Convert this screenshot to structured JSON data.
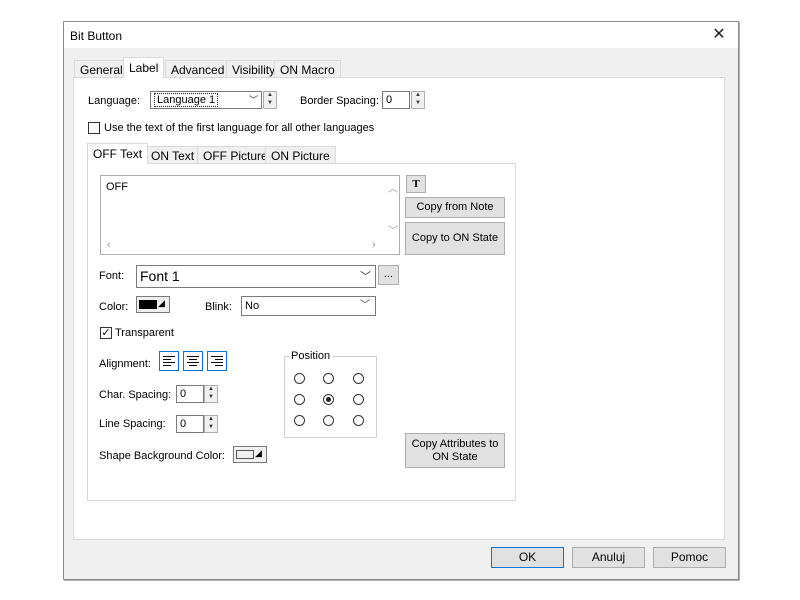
{
  "window": {
    "title": "Bit Button"
  },
  "main_tabs": [
    {
      "label": "General"
    },
    {
      "label": "Label"
    },
    {
      "label": "Advanced"
    },
    {
      "label": "Visibility"
    },
    {
      "label": "ON Macro"
    }
  ],
  "language": {
    "label": "Language:",
    "value": "Language 1"
  },
  "border_spacing": {
    "label": "Border Spacing:",
    "value": "0"
  },
  "use_first_language": {
    "label": "Use the text of the first language for all other languages",
    "checked": false
  },
  "sub_tabs": [
    {
      "label": "OFF Text"
    },
    {
      "label": "ON Text"
    },
    {
      "label": "OFF Picture"
    },
    {
      "label": "ON Picture"
    }
  ],
  "text_content": "OFF",
  "buttons": {
    "format_text": "T",
    "copy_from_note": "Copy from Note",
    "copy_to_on_state": "Copy to ON State",
    "font_browse": "...",
    "copy_attributes_line1": "Copy Attributes to",
    "copy_attributes_line2": "ON State"
  },
  "font": {
    "label": "Font:",
    "value": "Font 1"
  },
  "color": {
    "label": "Color:",
    "value": "#000000"
  },
  "blink": {
    "label": "Blink:",
    "value": "No"
  },
  "transparent": {
    "label": "Transparent",
    "checked": true
  },
  "alignment": {
    "label": "Alignment:"
  },
  "position": {
    "label": "Position",
    "selected": "middle-center"
  },
  "char_spacing": {
    "label": "Char. Spacing:",
    "value": "0"
  },
  "line_spacing": {
    "label": "Line Spacing:",
    "value": "0"
  },
  "shape_bg_color": {
    "label": "Shape Background Color:"
  },
  "footer": {
    "ok": "OK",
    "cancel": "Anuluj",
    "help": "Pomoc"
  },
  "colors": {
    "accent": "#0078d7",
    "panel": "#f0f0f0",
    "button": "#e1e1e1"
  }
}
